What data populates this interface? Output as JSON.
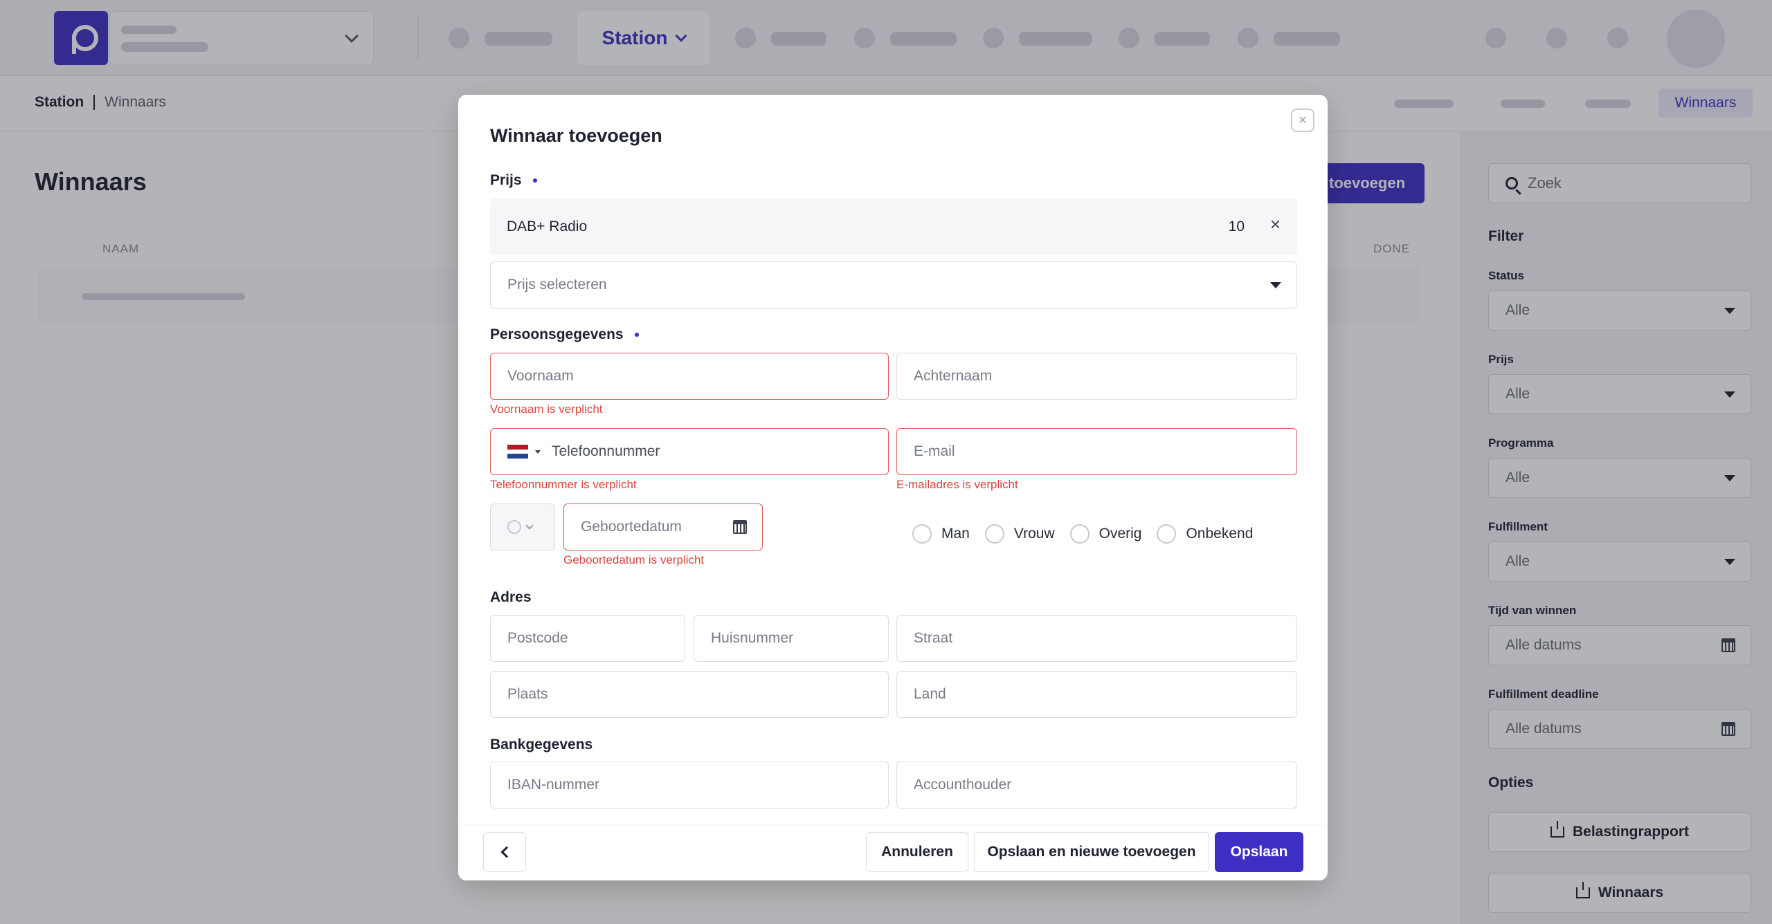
{
  "topbar": {
    "station_label": "Station"
  },
  "breadcrumb": {
    "root": "Station",
    "current": "Winnaars"
  },
  "subnav": {
    "active_tab": "Winnaars"
  },
  "page": {
    "title": "Winnaars",
    "col_name": "NAAM",
    "col_done": "DONE",
    "add_button": "toevoegen"
  },
  "sidebar": {
    "search_placeholder": "Zoek",
    "filter_title": "Filter",
    "filters": [
      {
        "label": "Status",
        "value": "Alle"
      },
      {
        "label": "Prijs",
        "value": "Alle"
      },
      {
        "label": "Programma",
        "value": "Alle"
      },
      {
        "label": "Fulfillment",
        "value": "Alle"
      },
      {
        "label": "Tijd van winnen",
        "value": "Alle datums"
      },
      {
        "label": "Fulfillment deadline",
        "value": "Alle datums"
      }
    ],
    "options_title": "Opties",
    "options": [
      "Belastingrapport",
      "Winnaars"
    ]
  },
  "modal": {
    "title": "Winnaar toevoegen",
    "prize_section": "Prijs",
    "selected_prize": {
      "name": "DAB+ Radio",
      "quantity": "10"
    },
    "prize_select_placeholder": "Prijs selecteren",
    "personal_section": "Persoonsgegevens",
    "first_name": {
      "placeholder": "Voornaam",
      "error": "Voornaam is verplicht"
    },
    "last_name": {
      "placeholder": "Achternaam"
    },
    "phone": {
      "placeholder": "Telefoonnummer",
      "error": "Telefoonnummer is verplicht"
    },
    "email": {
      "placeholder": "E-mail",
      "error": "E-mailadres is verplicht"
    },
    "birthdate": {
      "placeholder": "Geboortedatum",
      "error": "Geboortedatum is verplicht"
    },
    "gender_options": [
      "Man",
      "Vrouw",
      "Overig",
      "Onbekend"
    ],
    "address_section": "Adres",
    "address": {
      "postcode": "Postcode",
      "house_number": "Huisnummer",
      "street": "Straat",
      "city": "Plaats",
      "country": "Land"
    },
    "bank_section": "Bankgegevens",
    "bank": {
      "iban": "IBAN-nummer",
      "holder": "Accounthouder"
    },
    "footer": {
      "cancel": "Annuleren",
      "save_new": "Opslaan en nieuwe toevoegen",
      "save": "Opslaan"
    }
  },
  "colors": {
    "accent": "#3d2fc4",
    "error": "#d9453d"
  }
}
